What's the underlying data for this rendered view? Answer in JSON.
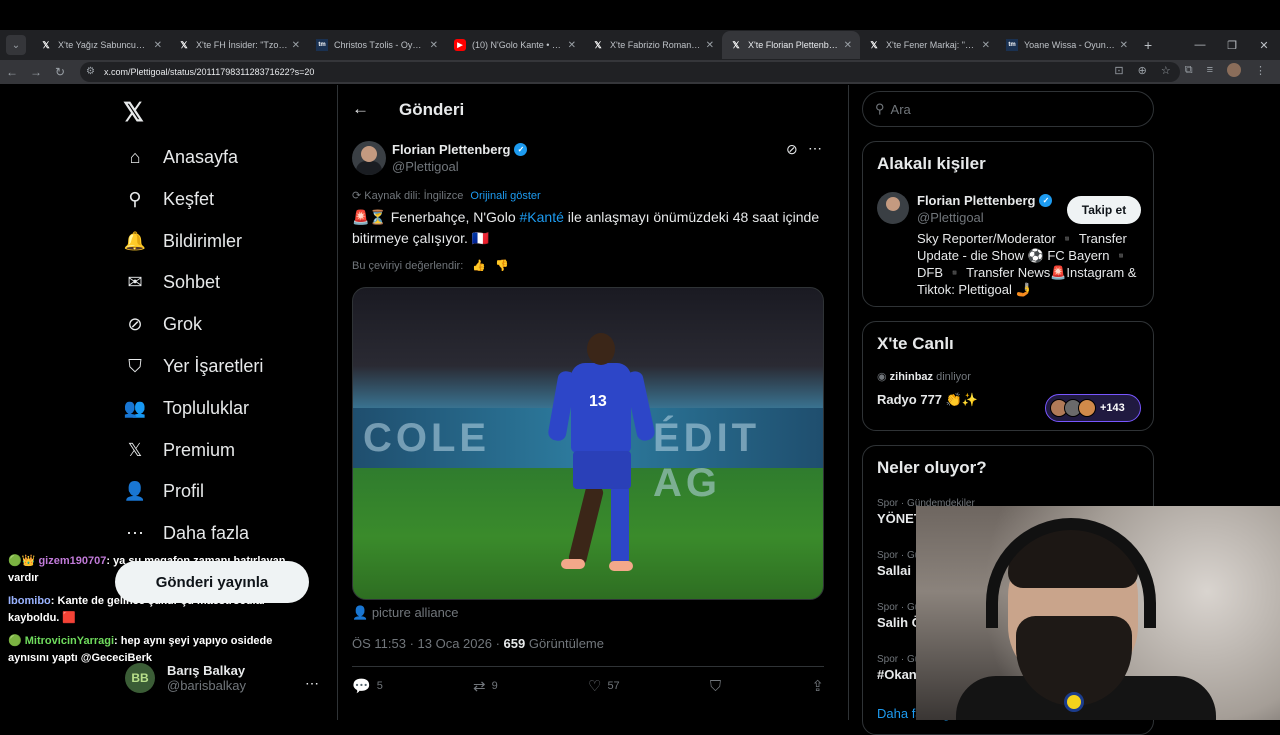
{
  "browser": {
    "tabs": [
      {
        "title": "X'te Yağız Sabuncuoğlu: \"",
        "favicon": "X",
        "active": false
      },
      {
        "title": "X'te FH İnsider: \"Tzolis iç",
        "favicon": "X",
        "active": false
      },
      {
        "title": "Christos Tzolis - Oyuncu p",
        "favicon": "tm",
        "active": false
      },
      {
        "title": "(10) N'Golo Kante • Fene",
        "favicon": "yt",
        "active": false
      },
      {
        "title": "X'te Fabrizio Romano: \"",
        "favicon": "X",
        "active": false
      },
      {
        "title": "X'te Florian Plettenberg: \"",
        "favicon": "X",
        "active": true
      },
      {
        "title": "X'te Fener Markaj: \"Ertan",
        "favicon": "X",
        "active": false
      },
      {
        "title": "Yoane Wissa - Oyuncu p",
        "favicon": "tm",
        "active": false
      }
    ],
    "url": "x.com/Plettigoal/status/2011179831128371622?s=20"
  },
  "nav": {
    "items": [
      {
        "label": "Anasayfa",
        "icon": "home-icon",
        "glyph": "⌂"
      },
      {
        "label": "Keşfet",
        "icon": "search-icon",
        "glyph": "⚲"
      },
      {
        "label": "Bildirimler",
        "icon": "bell-icon",
        "glyph": "🔔"
      },
      {
        "label": "Sohbet",
        "icon": "mail-icon",
        "glyph": "✉"
      },
      {
        "label": "Grok",
        "icon": "grok-icon",
        "glyph": "⊘"
      },
      {
        "label": "Yer İşaretleri",
        "icon": "bookmark-icon",
        "glyph": "⛉"
      },
      {
        "label": "Topluluklar",
        "icon": "communities-icon",
        "glyph": "👥"
      },
      {
        "label": "Premium",
        "icon": "x-premium-icon",
        "glyph": "𝕏"
      },
      {
        "label": "Profil",
        "icon": "profile-icon",
        "glyph": "👤"
      },
      {
        "label": "Daha fazla",
        "icon": "more-circle-icon",
        "glyph": "⋯"
      }
    ],
    "post_button": "Gönderi yayınla",
    "user": {
      "name": "Barış Balkay",
      "handle": "@barisbalkay"
    }
  },
  "chat": [
    {
      "user": "gizem190707",
      "text": ": ya şu megafon zamanı hatırlayan vardır"
    },
    {
      "user": "Ibomibo",
      "text": ": Kante de gelince şükür şu maestrocular kayboldu. 🟥"
    },
    {
      "user": "MitrovicinYarragi",
      "text": ": hep aynı şeyi yapıyo osidede aynısını yaptı @GececiBerk"
    }
  ],
  "post": {
    "header_title": "Gönderi",
    "author_name": "Florian Plettenberg",
    "author_handle": "@Plettigoal",
    "source_lang": "Kaynak dili: İngilizce",
    "show_original": "Orijinali göster",
    "text_prefix": "🚨⏳ Fenerbahçe, N'Golo ",
    "hashtag": "#Kanté",
    "text_suffix": " ile anlaşmayı önümüzdeki 48 saat içinde bitirmeye çalışıyor. 🇫🇷",
    "rate_translation": "Bu çeviriyi değerlendir:",
    "ad_left": "COLE",
    "ad_right": "ÉDIT AG",
    "jersey_number": "13",
    "media_credit": "picture alliance",
    "time": "ÖS 11:53 · 13 Oca 2026 · ",
    "views": "659",
    "views_label": " Görüntüleme",
    "replies": "5",
    "reposts": "9",
    "likes": "57"
  },
  "sidebar": {
    "search_placeholder": "Ara",
    "relevant_title": "Alakalı kişiler",
    "relevant": {
      "name": "Florian Plettenberg",
      "handle": "@Plettigoal",
      "follow": "Takip et",
      "bio": "Sky Reporter/Moderator ▪️ Transfer Update - die Show ⚽ FC Bayern ▪️ DFB ▪️ Transfer News🚨Instagram & Tiktok: Plettigoal 🤳"
    },
    "live_title": "X'te Canlı",
    "live_host": "zihinbaz",
    "live_listening": " dinliyor",
    "live_name": "Radyo 777 👏✨",
    "live_count": "+143",
    "trends_title": "Neler oluyor?",
    "trends": [
      {
        "category": "Spor · Gündemdekiler",
        "name": "YÖNETİM"
      },
      {
        "category": "Spor · Gündemdekiler",
        "name": "Sallai"
      },
      {
        "category": "Spor · Gündemdekiler",
        "name": "Salih Özcan"
      },
      {
        "category": "Spor · Gündemdekiler",
        "name": "#Okan"
      }
    ],
    "show_more": "Daha fazla göster"
  }
}
